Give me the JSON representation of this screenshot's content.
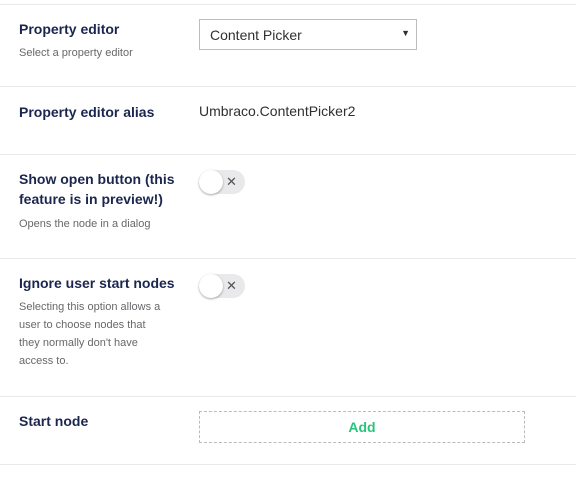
{
  "rows": [
    {
      "label": "Property editor",
      "description": "Select a property editor",
      "control": "select",
      "selected_value": "Content Picker"
    },
    {
      "label": "Property editor alias",
      "value": "Umbraco.ContentPicker2"
    },
    {
      "label_lines": [
        "Show open button (this",
        "feature is in preview!)"
      ],
      "description": "Opens the node in a dialog",
      "control": "toggle",
      "toggle_state": "off",
      "toggle_glyph": "✕"
    },
    {
      "label": "Ignore user start nodes",
      "description_lines": [
        "Selecting this option allows a",
        "user to choose nodes that",
        "they normally don't have",
        "access to."
      ],
      "control": "toggle",
      "toggle_state": "off",
      "toggle_glyph": "✕"
    },
    {
      "label": "Start node",
      "control": "button",
      "button_label": "Add"
    }
  ],
  "colors": {
    "label": "#1b264f",
    "description": "#68676b",
    "divider": "#e9e9eb",
    "add_button_text": "#2bc37c",
    "toggle_track": "#e9e9eb"
  },
  "icons": {
    "select_caret": "▼",
    "toggle_off": "close-icon"
  }
}
